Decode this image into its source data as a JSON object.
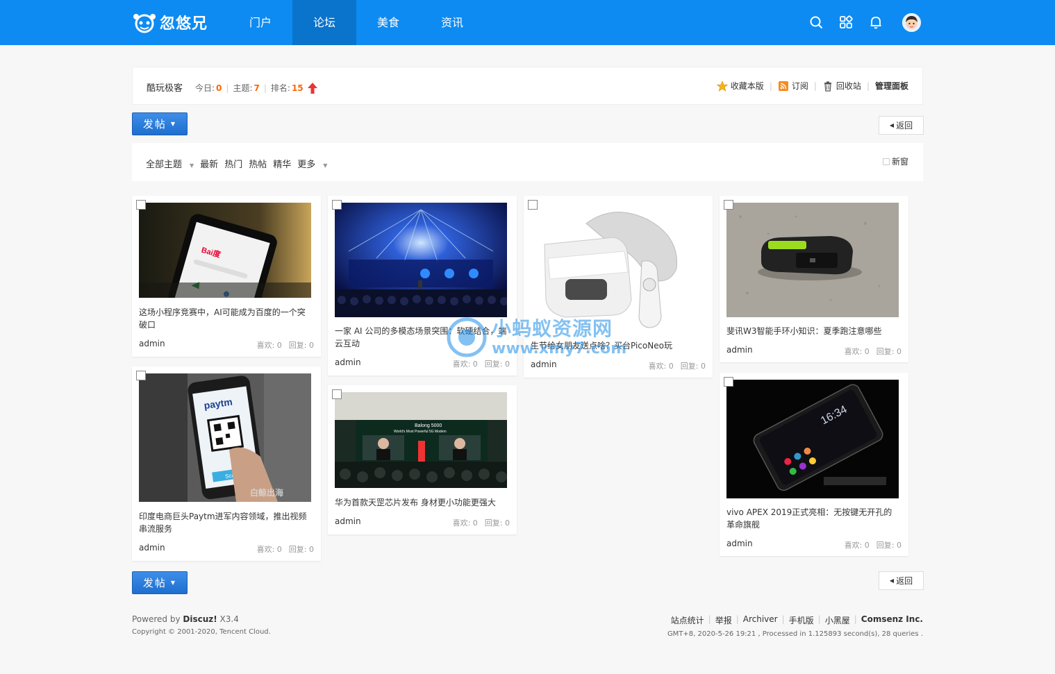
{
  "header": {
    "logo_text": "忽悠兄",
    "nav": [
      "门户",
      "论坛",
      "美食",
      "资讯"
    ],
    "active_nav": "论坛"
  },
  "forum": {
    "name": "酷玩极客",
    "today_label": "今日:",
    "today": "0",
    "topics_label": "主题:",
    "topics": "7",
    "rank_label": "排名:",
    "rank": "15",
    "actions": {
      "favorite": "收藏本版",
      "subscribe": "订阅",
      "recycle": "回收站",
      "admin": "管理面板"
    }
  },
  "toolbar": {
    "post_label": "发帖",
    "back_label": "返回"
  },
  "filters": {
    "all": "全部主题",
    "newest": "最新",
    "hot": "热门",
    "hot_posts": "热帖",
    "digest": "精华",
    "more": "更多",
    "new_window": "新窗"
  },
  "posts": [
    {
      "title": "这场小程序竞赛中，AI可能成为百度的一个突破口",
      "author": "admin",
      "likes": "喜欢: 0",
      "replies": "回复: 0"
    },
    {
      "title": "一家 AI 公司的多模态场景突围：软硬结合，端云互动",
      "author": "admin",
      "likes": "喜欢: 0",
      "replies": "回复: 0"
    },
    {
      "title": "生节给女朋友送点啥？买台PicoNeo玩",
      "author": "admin",
      "likes": "喜欢: 0",
      "replies": "回复: 0"
    },
    {
      "title": "斐讯W3智能手环小知识：夏季跑注意哪些",
      "author": "admin",
      "likes": "喜欢: 0",
      "replies": "回复: 0"
    },
    {
      "title": "印度电商巨头Paytm进军内容领域，推出视频串流服务",
      "author": "admin",
      "likes": "喜欢: 0",
      "replies": "回复: 0"
    },
    {
      "title": "华为首款天罡芯片发布 身材更小功能更强大",
      "author": "admin",
      "likes": "喜欢: 0",
      "replies": "回复: 0"
    },
    {
      "title": "vivo APEX 2019正式亮相：无按键无开孔的革命旗舰",
      "author": "admin",
      "likes": "喜欢: 0",
      "replies": "回复: 0"
    }
  ],
  "image_text": {
    "baidu_app": "Bai度",
    "paytm": "paytm",
    "paytm_scan": "Scan",
    "paytm_watermark": "白鲸出海",
    "kirin_stage": "Balong 5000",
    "kirin_sub": "World's Most Powerful 5G Modem",
    "phone_time": "16:34"
  },
  "watermark": {
    "cn": "小蚂蚁资源网",
    "en": "www.xmy7.com"
  },
  "footer": {
    "powered_prefix": "Powered by ",
    "powered_brand": "Discuz!",
    "powered_version": " X3.4",
    "copyright": "Copyright © 2001-2020, Tencent Cloud.",
    "links": [
      "站点统计",
      "举报",
      "Archiver",
      "手机版",
      "小黑屋"
    ],
    "company": "Comsenz Inc.",
    "timing": "GMT+8, 2020-5-26 19:21 , Processed in 1.125893 second(s), 28 queries ."
  },
  "colors": {
    "header_bg": "#0d8bf2",
    "nav_active": "#0a73cc",
    "stat_highlight": "#ff6600",
    "button_blue": "#1d6fcf"
  },
  "icons": [
    "logo-icon",
    "search-icon",
    "grid-icon",
    "bell-icon",
    "star-icon",
    "rss-icon",
    "trash-icon",
    "up-arrow-icon"
  ]
}
